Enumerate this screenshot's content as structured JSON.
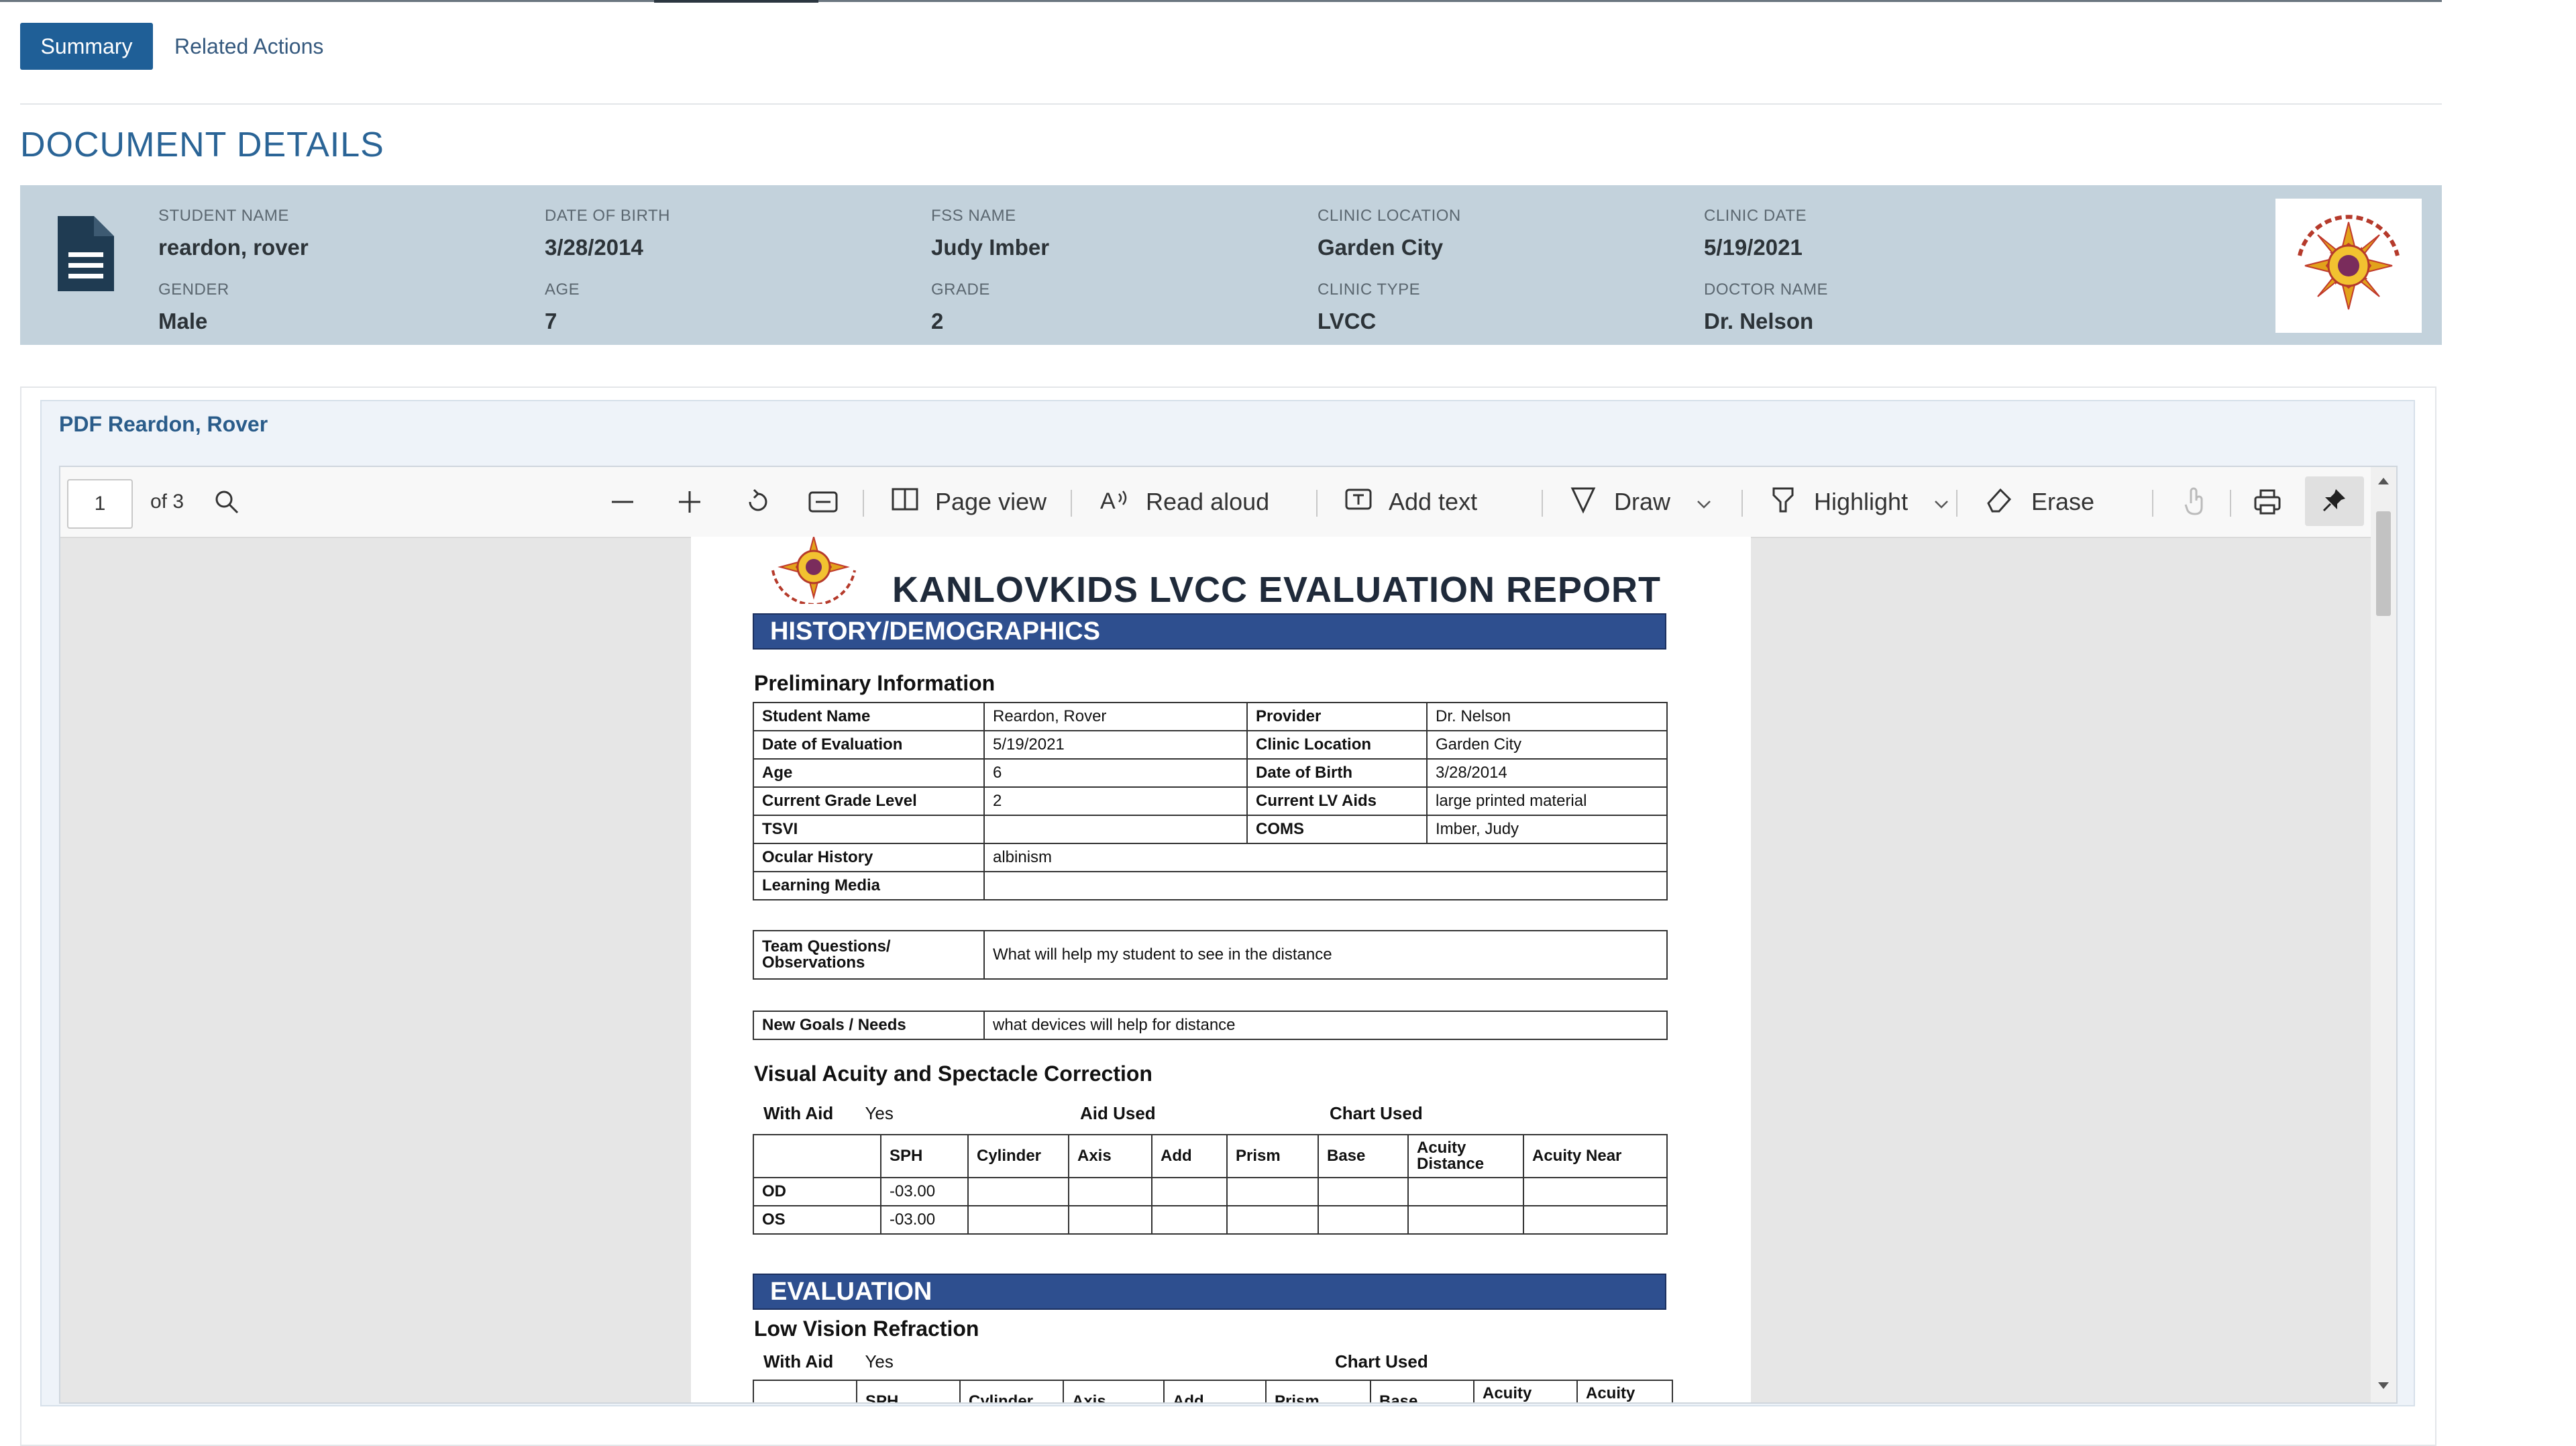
{
  "tabs": {
    "summary": "Summary",
    "related": "Related Actions"
  },
  "heading": "DOCUMENT DETAILS",
  "details": {
    "student_name": {
      "label": "STUDENT NAME",
      "value": "reardon, rover"
    },
    "dob": {
      "label": "DATE OF BIRTH",
      "value": "3/28/2014"
    },
    "fss": {
      "label": "FSS NAME",
      "value": "Judy Imber"
    },
    "clinic_location": {
      "label": "CLINIC LOCATION",
      "value": "Garden City"
    },
    "clinic_date": {
      "label": "CLINIC DATE",
      "value": "5/19/2021"
    },
    "gender": {
      "label": "GENDER",
      "value": "Male"
    },
    "age": {
      "label": "AGE",
      "value": "7"
    },
    "grade": {
      "label": "GRADE",
      "value": "2"
    },
    "clinic_type": {
      "label": "CLINIC TYPE",
      "value": "LVCC"
    },
    "doctor": {
      "label": "DOCTOR NAME",
      "value": "Dr. Nelson"
    }
  },
  "pdf": {
    "title": "PDF Reardon, Rover",
    "toolbar": {
      "page": "1",
      "of": "of 3",
      "page_view": "Page view",
      "read_aloud": "Read aloud",
      "add_text": "Add text",
      "draw": "Draw",
      "highlight": "Highlight",
      "erase": "Erase"
    },
    "report": {
      "title": "KANLOVKIDS LVCC EVALUATION REPORT",
      "history_banner": "HISTORY/DEMOGRAPHICS",
      "prelim": "Preliminary Information",
      "info_rows": [
        [
          "Student Name",
          "Reardon, Rover",
          "Provider",
          "Dr. Nelson"
        ],
        [
          "Date of Evaluation",
          "5/19/2021",
          "Clinic Location",
          "Garden City"
        ],
        [
          "Age",
          "6",
          "Date of Birth",
          "3/28/2014"
        ],
        [
          "Current Grade Level",
          "2",
          "Current LV Aids",
          "large printed material"
        ],
        [
          "TSVI",
          "",
          "COMS",
          "Imber, Judy"
        ]
      ],
      "ocular_label": "Ocular History",
      "ocular_value": "albinism",
      "learning_label": "Learning Media",
      "learning_value": "",
      "team_label_1": "Team Questions/",
      "team_label_2": "Observations",
      "team_value": "What will help my student to see in the distance",
      "goals_label": "New Goals / Needs",
      "goals_value": "what devices will help for distance",
      "va_title": "Visual Acuity and Spectacle Correction",
      "with_aid_label": "With Aid",
      "with_aid_value": "Yes",
      "aid_used": "Aid Used",
      "chart_used": "Chart Used",
      "va_headers": [
        "",
        "SPH",
        "Cylinder",
        "Axis",
        "Add",
        "Prism",
        "Base",
        "Acuity Distance",
        "Acuity Near"
      ],
      "va_rows": [
        [
          "OD",
          "-03.00",
          "",
          "",
          "",
          "",
          "",
          "",
          ""
        ],
        [
          "OS",
          "-03.00",
          "",
          "",
          "",
          "",
          "",
          "",
          ""
        ]
      ],
      "eval_banner": "EVALUATION",
      "lvr_title": "Low Vision Refraction",
      "lvr_with_aid_label": "With Aid",
      "lvr_with_aid_value": "Yes",
      "lvr_chart_used": "Chart Used",
      "lvr_headers": [
        "",
        "SPH",
        "Cylinder",
        "Axis",
        "Add",
        "Prism",
        "Base",
        "Acuity Distance",
        "Acuity Near"
      ]
    }
  }
}
